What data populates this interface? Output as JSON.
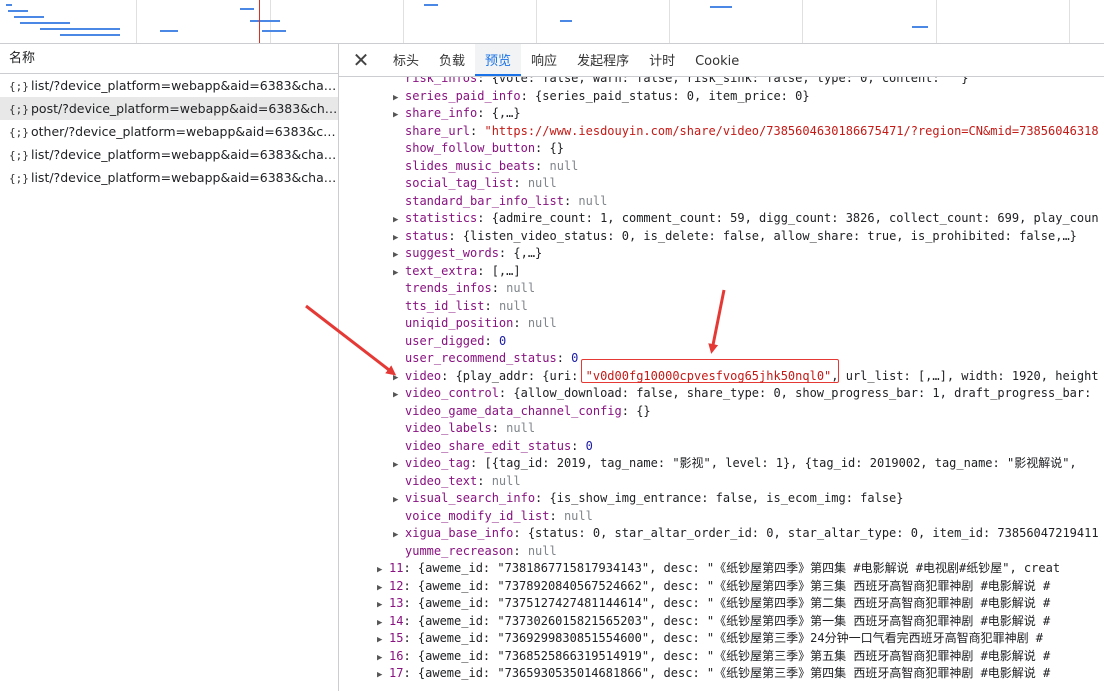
{
  "list": {
    "header": "名称",
    "requests": [
      {
        "name": "list/?device_platform=webapp&aid=6383&channe..."
      },
      {
        "name": "post/?device_platform=webapp&aid=6383&chan...",
        "selected": true
      },
      {
        "name": "other/?device_platform=webapp&aid=6383&chann..."
      },
      {
        "name": "list/?device_platform=webapp&aid=6383&channe..."
      },
      {
        "name": "list/?device_platform=webapp&aid=6383&channe..."
      }
    ],
    "icon_glyph": "{;}"
  },
  "tabs": [
    {
      "label": "标头"
    },
    {
      "label": "负载"
    },
    {
      "label": "预览",
      "active": true
    },
    {
      "label": "响应"
    },
    {
      "label": "发起程序"
    },
    {
      "label": "计时"
    },
    {
      "label": "Cookie"
    }
  ],
  "close_glyph": "✕",
  "preview_lines": [
    {
      "indent": 1,
      "expandable": false,
      "key": "risk_infos",
      "value": "{vote: false, warn: false, risk_sink: false, type: 0, content: \"\"}"
    },
    {
      "indent": 1,
      "expandable": true,
      "key": "series_paid_info",
      "value": "{series_paid_status: 0, item_price: 0}"
    },
    {
      "indent": 1,
      "expandable": true,
      "key": "share_info",
      "value": "{,…}"
    },
    {
      "indent": 1,
      "expandable": false,
      "key": "share_url",
      "value": "\"https://www.iesdouyin.com/share/video/7385604630186675471/?region=CN&mid=73856046318",
      "type": "string"
    },
    {
      "indent": 1,
      "expandable": false,
      "key": "show_follow_button",
      "value": "{}"
    },
    {
      "indent": 1,
      "expandable": false,
      "key": "slides_music_beats",
      "value": "null",
      "type": "null"
    },
    {
      "indent": 1,
      "expandable": false,
      "key": "social_tag_list",
      "value": "null",
      "type": "null"
    },
    {
      "indent": 1,
      "expandable": false,
      "key": "standard_bar_info_list",
      "value": "null",
      "type": "null"
    },
    {
      "indent": 1,
      "expandable": true,
      "key": "statistics",
      "value": "{admire_count: 1, comment_count: 59, digg_count: 3826, collect_count: 699, play_coun"
    },
    {
      "indent": 1,
      "expandable": true,
      "key": "status",
      "value": "{listen_video_status: 0, is_delete: false, allow_share: true, is_prohibited: false,…}"
    },
    {
      "indent": 1,
      "expandable": true,
      "key": "suggest_words",
      "value": "{,…}"
    },
    {
      "indent": 1,
      "expandable": true,
      "key": "text_extra",
      "value": "[,…]"
    },
    {
      "indent": 1,
      "expandable": false,
      "key": "trends_infos",
      "value": "null",
      "type": "null"
    },
    {
      "indent": 1,
      "expandable": false,
      "key": "tts_id_list",
      "value": "null",
      "type": "null"
    },
    {
      "indent": 1,
      "expandable": false,
      "key": "uniqid_position",
      "value": "null",
      "type": "null"
    },
    {
      "indent": 1,
      "expandable": false,
      "key": "user_digged",
      "value": "0",
      "type": "number"
    },
    {
      "indent": 1,
      "expandable": false,
      "key": "user_recommend_status",
      "value": "0",
      "type": "number"
    },
    {
      "indent": 1,
      "expandable": true,
      "key": "video",
      "value": "{play_addr: {uri: \"v0d00fg10000cpvesfvog65jhk50nql0\", url_list: [,…], width: 1920, height",
      "highlight": "\"v0d00fg10000cpvesfvog65jhk50nql0\""
    },
    {
      "indent": 1,
      "expandable": true,
      "key": "video_control",
      "value": "{allow_download: false, share_type: 0, show_progress_bar: 1, draft_progress_bar: "
    },
    {
      "indent": 1,
      "expandable": false,
      "key": "video_game_data_channel_config",
      "value": "{}"
    },
    {
      "indent": 1,
      "expandable": false,
      "key": "video_labels",
      "value": "null",
      "type": "null"
    },
    {
      "indent": 1,
      "expandable": false,
      "key": "video_share_edit_status",
      "value": "0",
      "type": "number"
    },
    {
      "indent": 1,
      "expandable": true,
      "key": "video_tag",
      "value": "[{tag_id: 2019, tag_name: \"影视\", level: 1}, {tag_id: 2019002, tag_name: \"影视解说\", "
    },
    {
      "indent": 1,
      "expandable": false,
      "key": "video_text",
      "value": "null",
      "type": "null"
    },
    {
      "indent": 1,
      "expandable": true,
      "key": "visual_search_info",
      "value": "{is_show_img_entrance: false, is_ecom_img: false}"
    },
    {
      "indent": 1,
      "expandable": false,
      "key": "voice_modify_id_list",
      "value": "null",
      "type": "null"
    },
    {
      "indent": 1,
      "expandable": true,
      "key": "xigua_base_info",
      "value": "{status: 0, star_altar_order_id: 0, star_altar_type: 0, item_id: 73856047219411"
    },
    {
      "indent": 1,
      "expandable": false,
      "key": "yumme_recreason",
      "value": "null",
      "type": "null"
    },
    {
      "indent": 0,
      "expandable": true,
      "key": "11",
      "value": "{aweme_id: \"7381867715817934143\", desc: \"《纸钞屋第四季》第四集 #电影解说 #电视剧#纸钞屋\", creat"
    },
    {
      "indent": 0,
      "expandable": true,
      "key": "12",
      "value": "{aweme_id: \"7378920840567524662\", desc: \"《纸钞屋第四季》第三集 西班牙高智商犯罪神剧 #电影解说 #"
    },
    {
      "indent": 0,
      "expandable": true,
      "key": "13",
      "value": "{aweme_id: \"7375127427481144614\", desc: \"《纸钞屋第四季》第二集 西班牙高智商犯罪神剧 #电影解说 #"
    },
    {
      "indent": 0,
      "expandable": true,
      "key": "14",
      "value": "{aweme_id: \"7373026015821565203\", desc: \"《纸钞屋第四季》第一集 西班牙高智商犯罪神剧 #电影解说 #"
    },
    {
      "indent": 0,
      "expandable": true,
      "key": "15",
      "value": "{aweme_id: \"7369299830851554600\", desc: \"《纸钞屋第三季》24分钟一口气看完西班牙高智商犯罪神剧 #"
    },
    {
      "indent": 0,
      "expandable": true,
      "key": "16",
      "value": "{aweme_id: \"7368525866319514919\", desc: \"《纸钞屋第三季》第五集 西班牙高智商犯罪神剧 #电影解说 #"
    },
    {
      "indent": 0,
      "expandable": true,
      "key": "17",
      "value": "{aweme_id: \"7365930535014681866\", desc: \"《纸钞屋第三季》第四集 西班牙高智商犯罪神剧 #电影解说 #"
    }
  ],
  "colors": {
    "accent": "#1a73e8",
    "key": "#881280",
    "string": "#c41a16",
    "number": "#1a1aa6",
    "null": "#80868b",
    "annotation": "#e53935"
  }
}
